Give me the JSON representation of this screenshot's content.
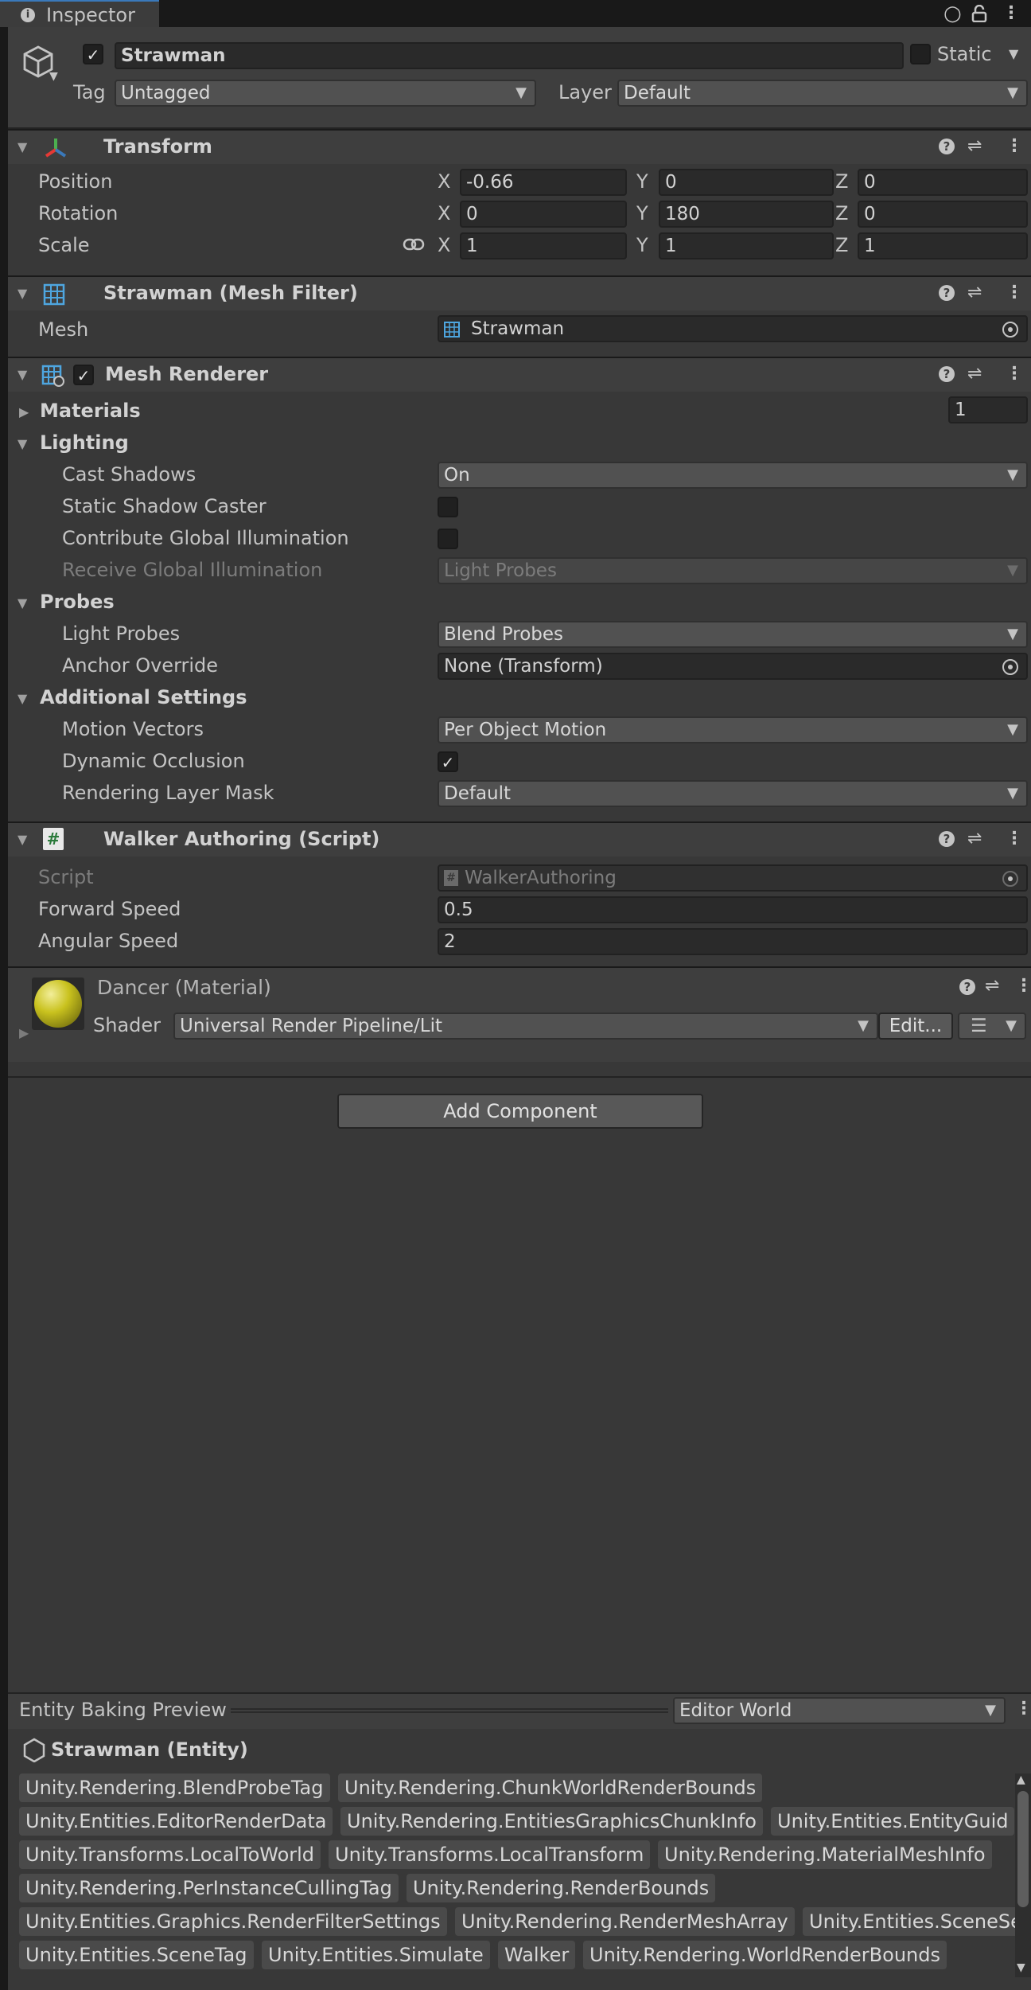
{
  "window": {
    "tab_label": "Inspector"
  },
  "header": {
    "object_name": "Strawman",
    "active": true,
    "static_label": "Static",
    "static_checked": false,
    "tag_label": "Tag",
    "tag_value": "Untagged",
    "layer_label": "Layer",
    "layer_value": "Default"
  },
  "transform": {
    "title": "Transform",
    "position_label": "Position",
    "rotation_label": "Rotation",
    "scale_label": "Scale",
    "axis_x": "X",
    "axis_y": "Y",
    "axis_z": "Z",
    "position": {
      "x": "-0.66",
      "y": "0",
      "z": "0"
    },
    "rotation": {
      "x": "0",
      "y": "180",
      "z": "0"
    },
    "scale": {
      "x": "1",
      "y": "1",
      "z": "1"
    }
  },
  "mesh_filter": {
    "title": "Strawman (Mesh Filter)",
    "mesh_label": "Mesh",
    "mesh_value": "Strawman"
  },
  "mesh_renderer": {
    "title": "Mesh Renderer",
    "enabled": true,
    "materials_label": "Materials",
    "materials_count": "1",
    "lighting_label": "Lighting",
    "cast_shadows_label": "Cast Shadows",
    "cast_shadows_value": "On",
    "static_shadow_caster_label": "Static Shadow Caster",
    "contribute_gi_label": "Contribute Global Illumination",
    "receive_gi_label": "Receive Global Illumination",
    "receive_gi_value": "Light Probes",
    "probes_label": "Probes",
    "light_probes_label": "Light Probes",
    "light_probes_value": "Blend Probes",
    "anchor_override_label": "Anchor Override",
    "anchor_override_value": "None (Transform)",
    "additional_label": "Additional Settings",
    "motion_vectors_label": "Motion Vectors",
    "motion_vectors_value": "Per Object Motion",
    "dynamic_occlusion_label": "Dynamic Occlusion",
    "dynamic_occlusion_checked": true,
    "rendering_layer_mask_label": "Rendering Layer Mask",
    "rendering_layer_mask_value": "Default"
  },
  "walker": {
    "title": "Walker Authoring (Script)",
    "script_label": "Script",
    "script_value": "WalkerAuthoring",
    "forward_speed_label": "Forward Speed",
    "forward_speed_value": "0.5",
    "angular_speed_label": "Angular Speed",
    "angular_speed_value": "2"
  },
  "material": {
    "title": "Dancer (Material)",
    "shader_label": "Shader",
    "shader_value": "Universal Render Pipeline/Lit",
    "edit_label": "Edit...",
    "sphere_color": "#c9c21e"
  },
  "add_component_label": "Add Component",
  "baking": {
    "title": "Entity Baking Preview",
    "world_value": "Editor World",
    "entity_name": "Strawman (Entity)",
    "tag_rows": [
      [
        "Unity.Rendering.BlendProbeTag",
        "Unity.Rendering.ChunkWorldRenderBounds"
      ],
      [
        "Unity.Entities.EditorRenderData",
        "Unity.Rendering.EntitiesGraphicsChunkInfo",
        "Unity.Entities.EntityGuid"
      ],
      [
        "Unity.Transforms.LocalToWorld",
        "Unity.Transforms.LocalTransform",
        "Unity.Rendering.MaterialMeshInfo"
      ],
      [
        "Unity.Rendering.PerInstanceCullingTag",
        "Unity.Rendering.RenderBounds"
      ],
      [
        "Unity.Entities.Graphics.RenderFilterSettings",
        "Unity.Rendering.RenderMeshArray",
        "Unity.Entities.SceneSection"
      ],
      [
        "Unity.Entities.SceneTag",
        "Unity.Entities.Simulate",
        "Walker",
        "Unity.Rendering.WorldRenderBounds"
      ]
    ]
  },
  "colors": {
    "panel": "#383838",
    "header": "#3e3e3e",
    "field": "#2a2a2a",
    "accent": "#3a79bb"
  }
}
